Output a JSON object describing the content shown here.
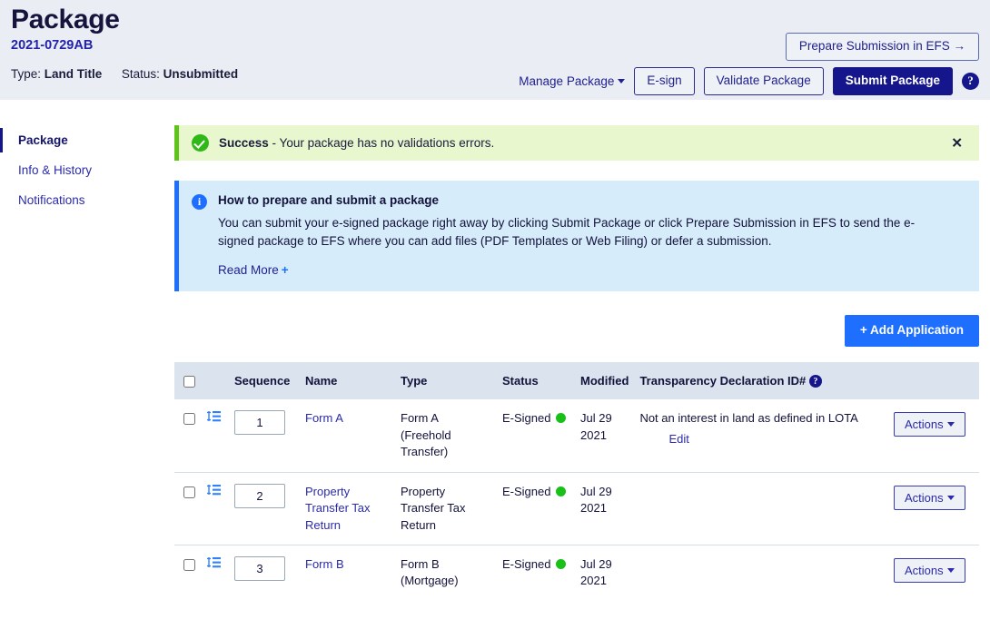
{
  "header": {
    "title": "Package",
    "package_id": "2021-0729AB",
    "type_label": "Type:",
    "type_value": "Land Title",
    "status_label": "Status:",
    "status_value": "Unsubmitted",
    "prepare_efs_button": "Prepare Submission in EFS  →",
    "manage_package_button": "Manage Package",
    "esign_button": "E-sign",
    "validate_button": "Validate Package",
    "submit_button": "Submit Package",
    "help_icon": "?"
  },
  "sidebar": {
    "items": [
      {
        "label": "Package"
      },
      {
        "label": "Info & History"
      },
      {
        "label": "Notifications"
      }
    ]
  },
  "alerts": {
    "success": {
      "strong": "Success",
      "rest": " - Your package has no validations errors.",
      "close": "✕"
    },
    "info": {
      "icon_glyph": "i",
      "title": "How to prepare and submit a package",
      "body": "You can submit your e-signed package right away by clicking Submit Package or click Prepare Submission in EFS to send the e-signed package to EFS where you can add files (PDF Templates or Web Filing) or defer a submission.",
      "read_more": "Read More",
      "read_more_plus": "+"
    }
  },
  "toolbar": {
    "add_application_button": "+ Add Application"
  },
  "table": {
    "columns": [
      "",
      "",
      "Sequence",
      "Name",
      "Type",
      "Status",
      "Modified",
      "Transparency Declaration ID#",
      ""
    ],
    "tdid_help_icon": "?",
    "rows": [
      {
        "sequence": "1",
        "name": "Form A",
        "type": "Form A (Freehold Transfer)",
        "status": "E-Signed",
        "modified": "Jul 29 2021",
        "tdid": "Not an interest in land as defined in LOTA",
        "tdid_edit": "Edit",
        "actions": "Actions"
      },
      {
        "sequence": "2",
        "name": "Property Transfer Tax Return",
        "type": "Property Transfer Tax Return",
        "status": "E-Signed",
        "modified": "Jul 29 2021",
        "tdid": "",
        "tdid_edit": "",
        "actions": "Actions"
      },
      {
        "sequence": "3",
        "name": "Form B",
        "type": "Form B (Mortgage)",
        "status": "E-Signed",
        "modified": "Jul 29 2021",
        "tdid": "",
        "tdid_edit": "",
        "actions": "Actions"
      }
    ]
  },
  "colors": {
    "brand_navy": "#15158c",
    "link_blue": "#2b2bab",
    "accent_blue": "#1f6fff",
    "success_green": "#5ec41a",
    "status_dot_green": "#18c018",
    "header_bg": "#eaeef4",
    "table_header_bg": "#dbe4ee"
  }
}
